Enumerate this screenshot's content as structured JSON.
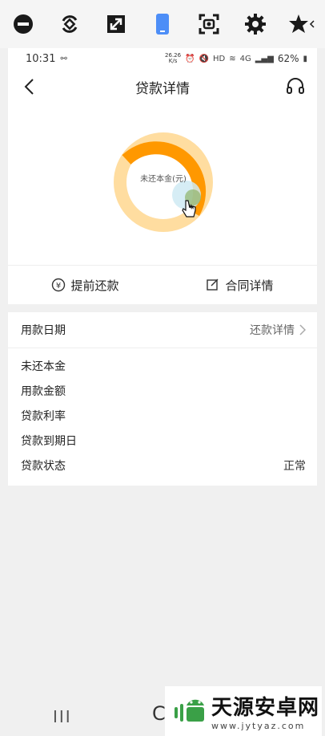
{
  "toolbar": {
    "icons": [
      "minus-circle-icon",
      "rotate-icon",
      "expand-icon",
      "phone-icon",
      "screenshot-icon",
      "gear-icon",
      "star-icon"
    ]
  },
  "statusbar": {
    "time": "10:31",
    "speed_top": "26.26",
    "speed_unit": "K/s",
    "network": "HD",
    "signal": "4G",
    "battery": "62%"
  },
  "navbar": {
    "title": "贷款详情"
  },
  "chart": {
    "center_label": "未还本金(元)",
    "colors": {
      "accent": "#ff9800",
      "light": "#ffdda0"
    }
  },
  "actions": {
    "prepay": "提前还款",
    "contract": "合同详情"
  },
  "details": {
    "header_label": "用款日期",
    "header_link": "还款详情",
    "rows": [
      {
        "label": "未还本金",
        "value": ""
      },
      {
        "label": "用款金额",
        "value": ""
      },
      {
        "label": "贷款利率",
        "value": ""
      },
      {
        "label": "贷款到期日",
        "value": ""
      },
      {
        "label": "贷款状态",
        "value": "正常"
      }
    ]
  },
  "bottom_nav": {
    "recent": "III",
    "home": "C"
  },
  "watermark": {
    "title": "天源安卓网",
    "url": "www.jytyaz.com"
  }
}
